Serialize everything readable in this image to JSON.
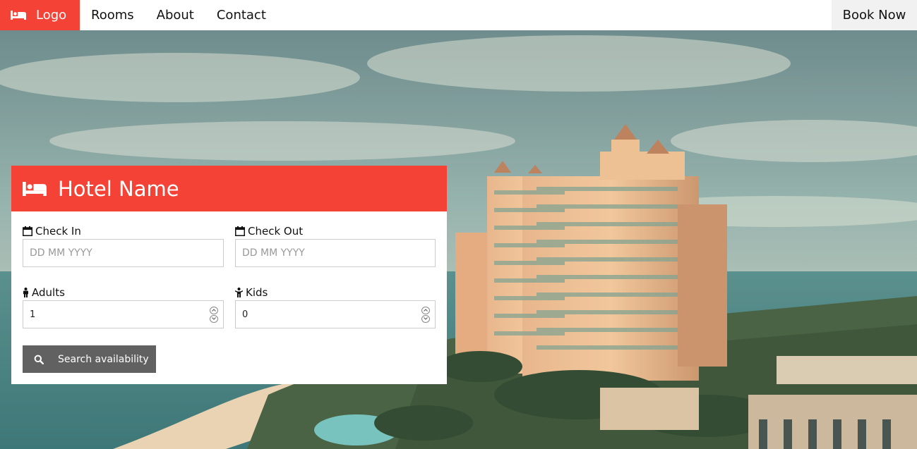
{
  "nav": {
    "logo_label": "Logo",
    "links": [
      "Rooms",
      "About",
      "Contact"
    ],
    "cta_label": "Book Now"
  },
  "booking": {
    "title": "Hotel Name",
    "check_in": {
      "label": "Check In",
      "placeholder": "DD MM YYYY"
    },
    "check_out": {
      "label": "Check Out",
      "placeholder": "DD MM YYYY"
    },
    "adults": {
      "label": "Adults",
      "value": "1"
    },
    "kids": {
      "label": "Kids",
      "value": "0"
    },
    "search_label": "Search availability"
  },
  "colors": {
    "accent": "#f44336",
    "button": "#616161",
    "cta_bg": "#f1f1f1"
  },
  "icons": [
    "bed-icon",
    "calendar-icon",
    "male-icon",
    "child-icon",
    "search-icon",
    "spinner-up-icon",
    "spinner-down-icon"
  ]
}
